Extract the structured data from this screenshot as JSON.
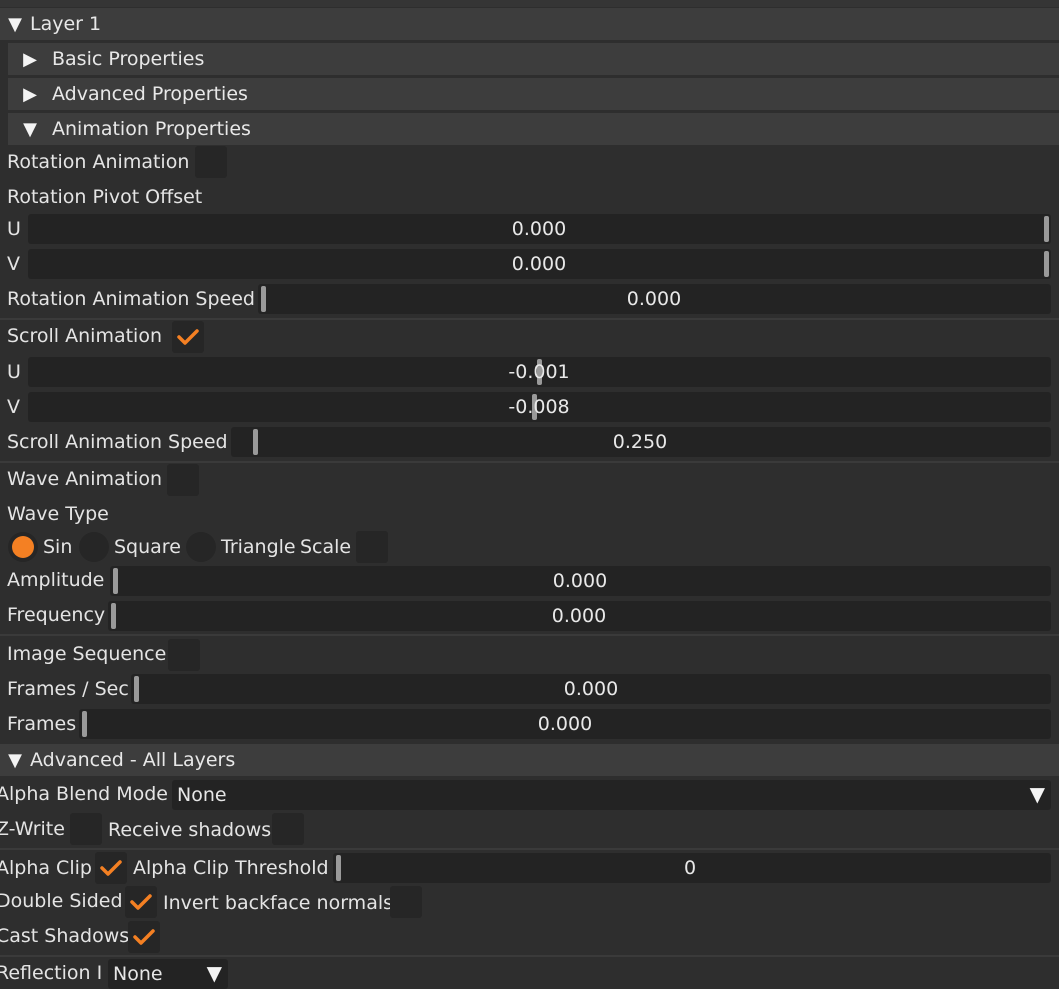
{
  "layer_title": "Layer 1",
  "sections": {
    "basic": "Basic Properties",
    "advanced": "Advanced Properties",
    "animation": "Animation Properties",
    "advanced_all": "Advanced - All Layers"
  },
  "rotation": {
    "label": "Rotation Animation",
    "enabled": false,
    "pivot_label": "Rotation Pivot Offset",
    "u_label": "U",
    "u_value": "0.000",
    "v_label": "V",
    "v_value": "0.000",
    "speed_label": "Rotation Animation Speed",
    "speed_value": "0.000"
  },
  "scroll": {
    "label": "Scroll Animation",
    "enabled": true,
    "u_label": "U",
    "u_value": "-0.001",
    "v_label": "V",
    "v_value": "-0.008",
    "speed_label": "Scroll Animation Speed",
    "speed_value": "0.250"
  },
  "wave": {
    "label": "Wave Animation",
    "enabled": false,
    "type_label": "Wave Type",
    "options": [
      "Sin",
      "Square",
      "Triangle"
    ],
    "selected": "Sin",
    "scale_label": "Scale",
    "amplitude_label": "Amplitude",
    "amplitude_value": "0.000",
    "frequency_label": "Frequency",
    "frequency_value": "0.000"
  },
  "image_sequence": {
    "label": "Image Sequence",
    "fps_label": "Frames / Sec",
    "fps_value": "0.000",
    "frames_label": "Frames",
    "frames_value": "0.000"
  },
  "advanced_all": {
    "alpha_blend_label": "Alpha Blend Mode",
    "alpha_blend_value": "None",
    "zwrite_label": "Z-Write",
    "receive_shadows_label": "Receive shadows",
    "alpha_clip_label": "Alpha Clip",
    "alpha_clip_threshold_label": "Alpha Clip Threshold",
    "alpha_clip_threshold_value": "0",
    "double_sided_label": "Double Sided",
    "invert_backface_label": "Invert backface normals",
    "cast_shadows_label": "Cast Shadows",
    "reflection_label": "Reflection I",
    "reflection_value": "None"
  },
  "icons": {
    "expanded": "triangle-down-icon",
    "collapsed": "triangle-right-icon",
    "check": "checkmark-icon",
    "dropdown": "dropdown-arrow-icon"
  },
  "colors": {
    "accent": "#f48023",
    "background": "#2e2e2e",
    "field": "#232323",
    "header": "#3d3d3d"
  }
}
